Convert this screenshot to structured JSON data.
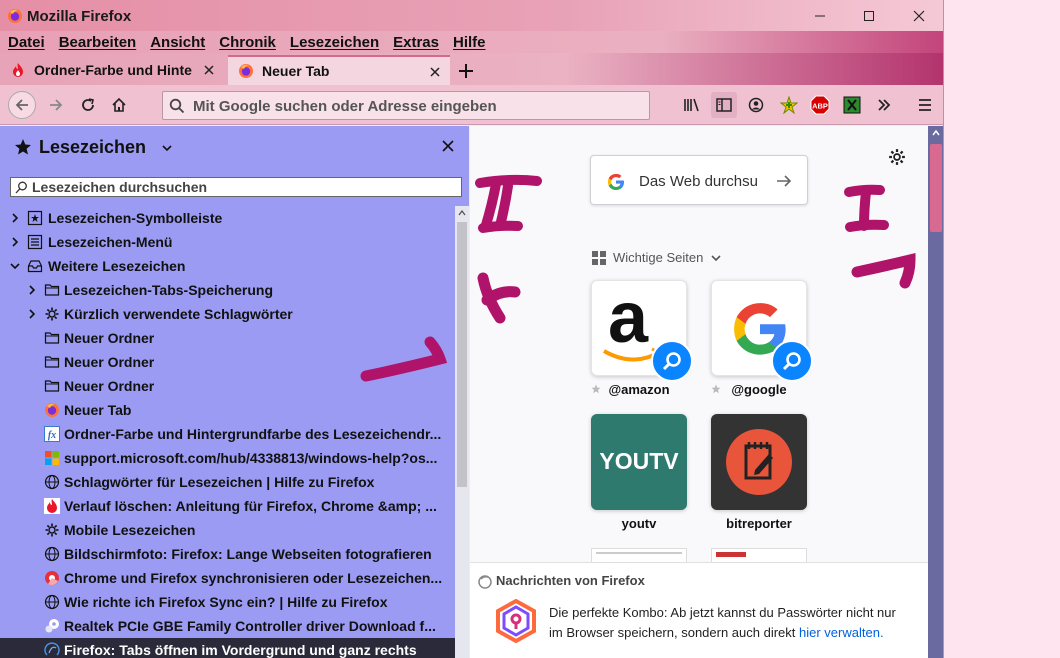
{
  "window": {
    "title": "Mozilla Firefox"
  },
  "menu": [
    "Datei",
    "Bearbeiten",
    "Ansicht",
    "Chronik",
    "Lesezeichen",
    "Extras",
    "Hilfe"
  ],
  "tabs": [
    {
      "label": "Ordner-Farbe und Hinte",
      "active": false
    },
    {
      "label": "Neuer Tab",
      "active": true
    }
  ],
  "urlbar": {
    "placeholder": "Mit Google suchen oder Adresse eingeben"
  },
  "sidebar": {
    "title": "Lesezeichen",
    "search_placeholder": "Lesezeichen durchsuchen",
    "items": [
      {
        "label": "Lesezeichen-Symbolleiste",
        "icon": "bookmark-toolbar-icon"
      },
      {
        "label": "Lesezeichen-Menü",
        "icon": "bookmark-menu-icon"
      },
      {
        "label": "Weitere Lesezeichen",
        "icon": "other-bookmarks-icon"
      },
      {
        "label": "Lesezeichen-Tabs-Speicherung",
        "icon": "folder-icon"
      },
      {
        "label": "Kürzlich verwendete Schlagwörter",
        "icon": "gear-icon"
      },
      {
        "label": "Neuer Ordner",
        "icon": "folder-icon"
      },
      {
        "label": "Neuer Ordner",
        "icon": "folder-icon"
      },
      {
        "label": "Neuer Ordner",
        "icon": "folder-icon"
      },
      {
        "label": "Neuer Tab",
        "icon": "firefox-icon"
      },
      {
        "label": "Ordner-Farbe und Hintergrundfarbe des Lesezeichendr...",
        "icon": "fx-site-icon"
      },
      {
        "label": "support.microsoft.com/hub/4338813/windows-help?os...",
        "icon": "microsoft-icon"
      },
      {
        "label": "Schlagwörter für Lesezeichen | Hilfe zu Firefox",
        "icon": "globe-icon"
      },
      {
        "label": "Verlauf löschen: Anleitung für Firefox, Chrome &amp; ...",
        "icon": "flame-icon"
      },
      {
        "label": "Mobile Lesezeichen",
        "icon": "gear-icon"
      },
      {
        "label": "Bildschirmfoto: Firefox: Lange Webseiten fotografieren",
        "icon": "globe-icon"
      },
      {
        "label": "Chrome und Firefox synchronisieren oder Lesezeichen...",
        "icon": "chrome-site-icon"
      },
      {
        "label": "Wie richte ich Firefox Sync ein? | Hilfe zu Firefox",
        "icon": "globe-icon"
      },
      {
        "label": "Realtek PCIe GBE Family Controller driver Download f...",
        "icon": "realtek-icon"
      },
      {
        "label": "Firefox: Tabs öffnen im Vordergrund und ganz rechts",
        "icon": "firefox-site-icon"
      }
    ]
  },
  "newtab": {
    "search_text": "Das Web durchsu",
    "topsites_label": "Wichtige Seiten",
    "tiles": [
      {
        "name": "@amazon",
        "title_text": "a"
      },
      {
        "name": "@google",
        "title_text": "G"
      },
      {
        "name": "youtv",
        "title_text": "YOUTV",
        "color": "#2f7a6f"
      },
      {
        "name": "bitreporter",
        "color": "#333333"
      }
    ],
    "news": {
      "header": "Nachrichten von Firefox",
      "text": "Die perfekte Kombo: Ab jetzt kannst du Passwörter nicht nur im Browser speichern, sondern auch direkt ",
      "link": "hier verwalten."
    }
  },
  "colors": {
    "sidebar_bg": "#9b9bf4",
    "annotation": "#b0136a",
    "accent": "#0a84ff"
  }
}
